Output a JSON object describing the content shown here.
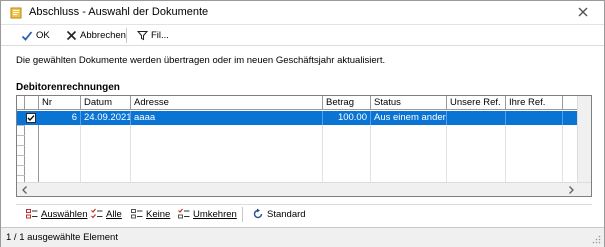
{
  "window": {
    "title": "Abschluss - Auswahl der Dokumente"
  },
  "toolbar": {
    "ok_label": "OK",
    "cancel_label": "Abbrechen",
    "filter_label": "Fil..."
  },
  "description": "Die gewählten Dokumente werden übertragen oder im neuen Geschäftsjahr aktualisiert.",
  "section_title": "Debitorenrechnungen",
  "grid": {
    "columns": [
      "Nr",
      "Datum",
      "Adresse",
      "Betrag",
      "Status",
      "Unsere Ref.",
      "Ihre Ref."
    ],
    "rows": [
      {
        "nr": "6",
        "datum": "24.09.2021",
        "adresse": "aaaa",
        "betrag": "100.00",
        "status": "Aus einem anderen",
        "unsere_ref": "",
        "ihre_ref": "",
        "checked": true
      }
    ]
  },
  "bottom": {
    "auswaehlen_label": "Auswählen",
    "alle_label": "Alle",
    "keine_label": "Keine",
    "umkehren_label": "Umkehren",
    "standard_label": "Standard"
  },
  "status_bar": {
    "text": "1 / 1 ausgewählte Element"
  },
  "colors": {
    "selection": "#0a74d4",
    "accent_check": "#2a5db0",
    "close": "#666666"
  }
}
